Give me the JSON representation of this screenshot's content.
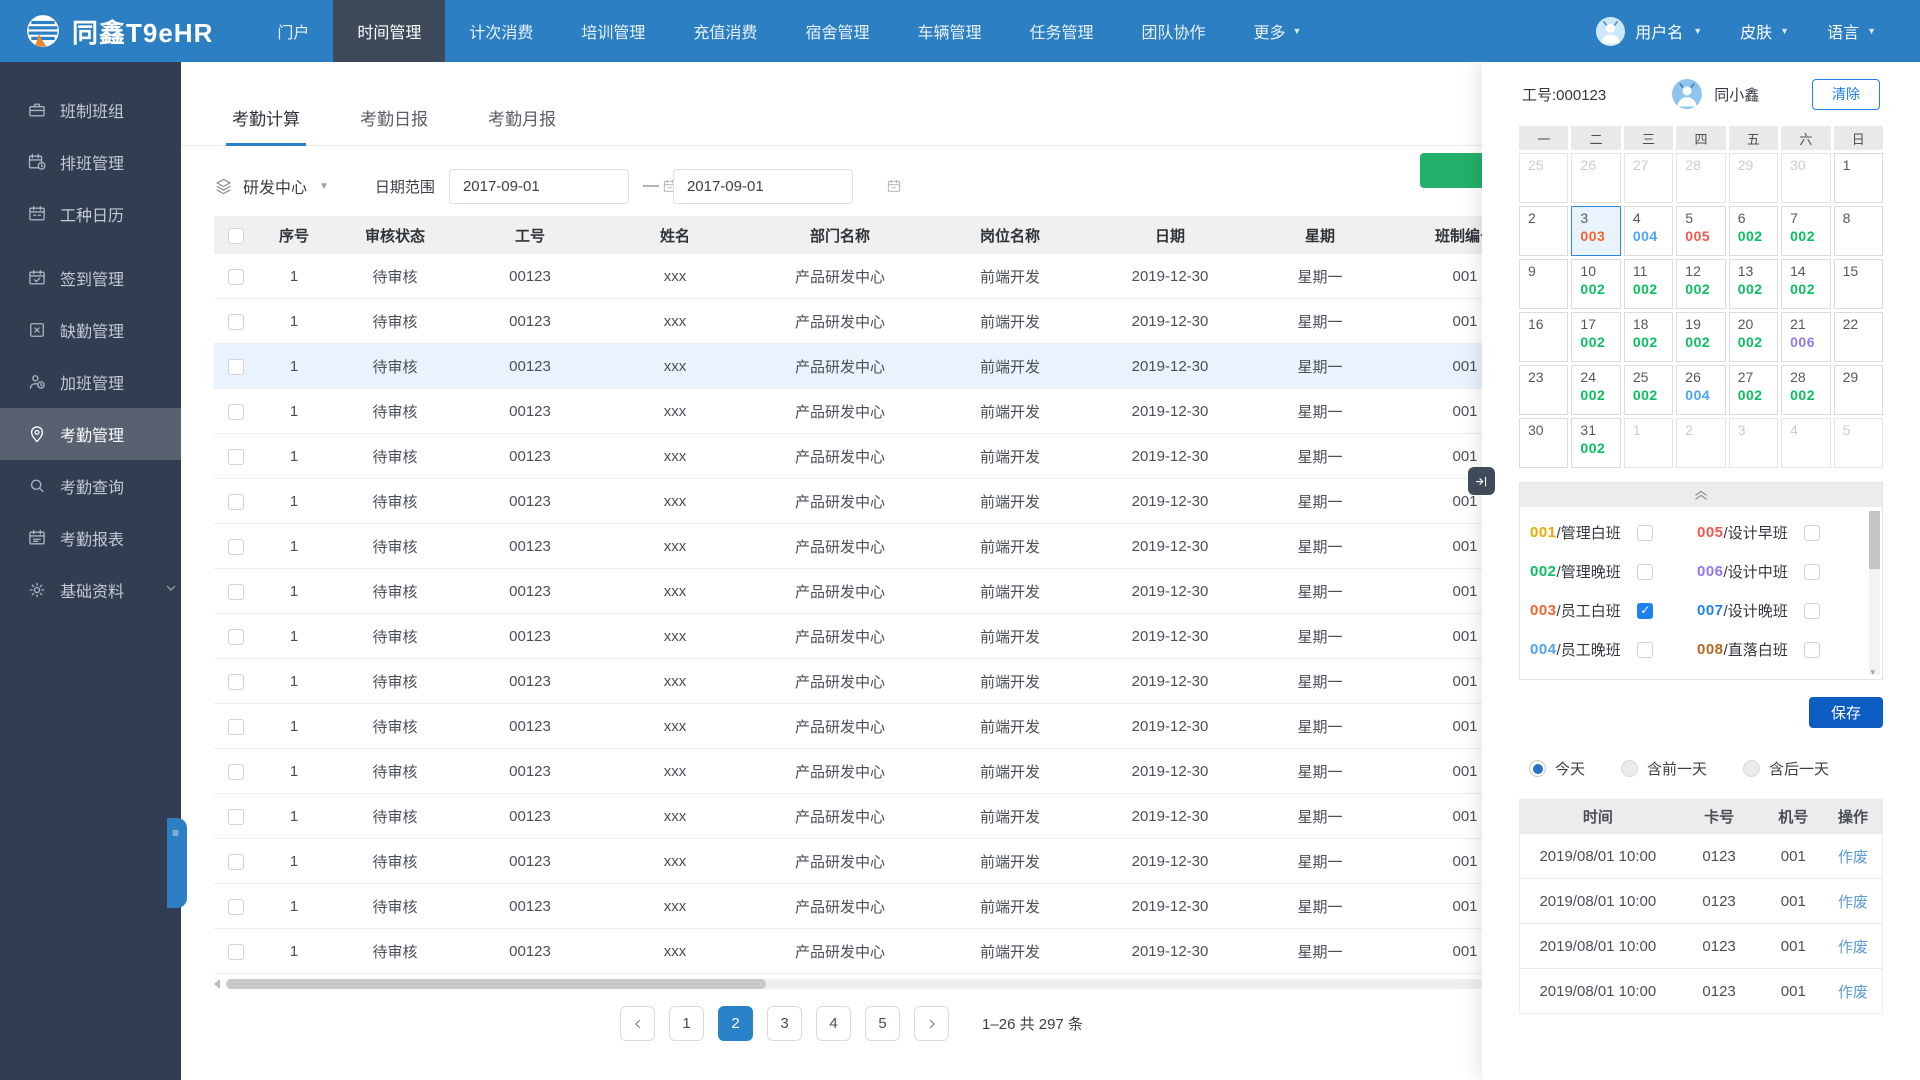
{
  "navbar": {
    "brand": "同鑫T9eHR",
    "menu": [
      {
        "label": "门户"
      },
      {
        "label": "时间管理"
      },
      {
        "label": "计次消费"
      },
      {
        "label": "培训管理"
      },
      {
        "label": "充值消费"
      },
      {
        "label": "宿舍管理"
      },
      {
        "label": "车辆管理"
      },
      {
        "label": "任务管理"
      },
      {
        "label": "团队协作"
      },
      {
        "label": "更多",
        "caret": true
      }
    ],
    "active_index": 1,
    "user": "用户名",
    "skin": "皮肤",
    "language": "语言"
  },
  "sidebar": {
    "items": [
      {
        "icon": "briefcase-icon",
        "label": "班制班组"
      },
      {
        "icon": "calendar-clock-icon",
        "label": "排班管理"
      },
      {
        "icon": "calendar-icon",
        "label": "工种日历"
      },
      {
        "icon": "calendar-check-icon",
        "label": "签到管理",
        "group_gap": true
      },
      {
        "icon": "calendar-x-icon",
        "label": "缺勤管理"
      },
      {
        "icon": "person-clock-icon",
        "label": "加班管理"
      },
      {
        "icon": "location-pin-icon",
        "label": "考勤管理",
        "active": true
      },
      {
        "icon": "search-icon",
        "label": "考勤查询"
      },
      {
        "icon": "calendar-report-icon",
        "label": "考勤报表"
      },
      {
        "icon": "gear-icon",
        "label": "基础资料",
        "caret": true
      }
    ]
  },
  "tabs": [
    {
      "label": "考勤计算",
      "active": true
    },
    {
      "label": "考勤日报"
    },
    {
      "label": "考勤月报"
    }
  ],
  "filters": {
    "department": "研发中心",
    "date_label": "日期范围",
    "date_from": "2017-09-01",
    "date_to": "2017-09-01",
    "range_separator": "—"
  },
  "table": {
    "columns": [
      "",
      "序号",
      "审核状态",
      "工号",
      "姓名",
      "部门名称",
      "岗位名称",
      "日期",
      "星期",
      "班制编号"
    ],
    "highlight_row": 2,
    "rows": [
      [
        "1",
        "待审核",
        "00123",
        "xxx",
        "产品研发中心",
        "前端开发",
        "2019-12-30",
        "星期一",
        "001"
      ],
      [
        "1",
        "待审核",
        "00123",
        "xxx",
        "产品研发中心",
        "前端开发",
        "2019-12-30",
        "星期一",
        "001"
      ],
      [
        "1",
        "待审核",
        "00123",
        "xxx",
        "产品研发中心",
        "前端开发",
        "2019-12-30",
        "星期一",
        "001"
      ],
      [
        "1",
        "待审核",
        "00123",
        "xxx",
        "产品研发中心",
        "前端开发",
        "2019-12-30",
        "星期一",
        "001"
      ],
      [
        "1",
        "待审核",
        "00123",
        "xxx",
        "产品研发中心",
        "前端开发",
        "2019-12-30",
        "星期一",
        "001"
      ],
      [
        "1",
        "待审核",
        "00123",
        "xxx",
        "产品研发中心",
        "前端开发",
        "2019-12-30",
        "星期一",
        "001"
      ],
      [
        "1",
        "待审核",
        "00123",
        "xxx",
        "产品研发中心",
        "前端开发",
        "2019-12-30",
        "星期一",
        "001"
      ],
      [
        "1",
        "待审核",
        "00123",
        "xxx",
        "产品研发中心",
        "前端开发",
        "2019-12-30",
        "星期一",
        "001"
      ],
      [
        "1",
        "待审核",
        "00123",
        "xxx",
        "产品研发中心",
        "前端开发",
        "2019-12-30",
        "星期一",
        "001"
      ],
      [
        "1",
        "待审核",
        "00123",
        "xxx",
        "产品研发中心",
        "前端开发",
        "2019-12-30",
        "星期一",
        "001"
      ],
      [
        "1",
        "待审核",
        "00123",
        "xxx",
        "产品研发中心",
        "前端开发",
        "2019-12-30",
        "星期一",
        "001"
      ],
      [
        "1",
        "待审核",
        "00123",
        "xxx",
        "产品研发中心",
        "前端开发",
        "2019-12-30",
        "星期一",
        "001"
      ],
      [
        "1",
        "待审核",
        "00123",
        "xxx",
        "产品研发中心",
        "前端开发",
        "2019-12-30",
        "星期一",
        "001"
      ],
      [
        "1",
        "待审核",
        "00123",
        "xxx",
        "产品研发中心",
        "前端开发",
        "2019-12-30",
        "星期一",
        "001"
      ],
      [
        "1",
        "待审核",
        "00123",
        "xxx",
        "产品研发中心",
        "前端开发",
        "2019-12-30",
        "星期一",
        "001"
      ],
      [
        "1",
        "待审核",
        "00123",
        "xxx",
        "产品研发中心",
        "前端开发",
        "2019-12-30",
        "星期一",
        "001"
      ]
    ]
  },
  "pagination": {
    "pages": [
      "1",
      "2",
      "3",
      "4",
      "5"
    ],
    "active_page": "2",
    "summary": "1–26  共 297 条"
  },
  "panel": {
    "employee_label": "工号:000123",
    "employee_name": "同小鑫",
    "clear_button": "清除",
    "calendar": {
      "weekdays": [
        "一",
        "二",
        "三",
        "四",
        "五",
        "六",
        "日"
      ],
      "cells": [
        {
          "d": "25",
          "muted": true
        },
        {
          "d": "26",
          "muted": true
        },
        {
          "d": "27",
          "muted": true
        },
        {
          "d": "28",
          "muted": true
        },
        {
          "d": "29",
          "muted": true
        },
        {
          "d": "30",
          "muted": true
        },
        {
          "d": "1"
        },
        {
          "d": "2"
        },
        {
          "d": "3",
          "code": "003",
          "selected": true
        },
        {
          "d": "4",
          "code": "004"
        },
        {
          "d": "5",
          "code": "005"
        },
        {
          "d": "6",
          "code": "002"
        },
        {
          "d": "7",
          "code": "002"
        },
        {
          "d": "8"
        },
        {
          "d": "9"
        },
        {
          "d": "10",
          "code": "002"
        },
        {
          "d": "11",
          "code": "002"
        },
        {
          "d": "12",
          "code": "002"
        },
        {
          "d": "13",
          "code": "002"
        },
        {
          "d": "14",
          "code": "002"
        },
        {
          "d": "15"
        },
        {
          "d": "16"
        },
        {
          "d": "17",
          "code": "002"
        },
        {
          "d": "18",
          "code": "002"
        },
        {
          "d": "19",
          "code": "002"
        },
        {
          "d": "20",
          "code": "002"
        },
        {
          "d": "21",
          "code": "006"
        },
        {
          "d": "22"
        },
        {
          "d": "23"
        },
        {
          "d": "24",
          "code": "002"
        },
        {
          "d": "25",
          "code": "002"
        },
        {
          "d": "26",
          "code": "004"
        },
        {
          "d": "27",
          "code": "002"
        },
        {
          "d": "28",
          "code": "002"
        },
        {
          "d": "29"
        },
        {
          "d": "30"
        },
        {
          "d": "31",
          "code": "002"
        },
        {
          "d": "1",
          "muted": true
        },
        {
          "d": "2",
          "muted": true
        },
        {
          "d": "3",
          "muted": true
        },
        {
          "d": "4",
          "muted": true
        },
        {
          "d": "5",
          "muted": true
        }
      ]
    },
    "shift_colors": {
      "001": "#f0a800",
      "002": "#0abf5f",
      "003": "#f2642c",
      "004": "#4aa3f5",
      "005": "#f5554f",
      "006": "#8d7af0",
      "007": "#2180f0",
      "008": "#b5691e"
    },
    "shifts": [
      {
        "code": "001",
        "name": "管理白班",
        "checked": false
      },
      {
        "code": "002",
        "name": "管理晚班",
        "checked": false
      },
      {
        "code": "003",
        "name": "员工白班",
        "checked": true
      },
      {
        "code": "004",
        "name": "员工晚班",
        "checked": false
      },
      {
        "code": "005",
        "name": "设计早班",
        "checked": false
      },
      {
        "code": "006",
        "name": "设计中班",
        "checked": false
      },
      {
        "code": "007",
        "name": "设计晚班",
        "checked": false
      },
      {
        "code": "008",
        "name": "直落白班",
        "checked": false
      }
    ],
    "save_button": "保存",
    "radios": [
      {
        "label": "今天",
        "selected": true
      },
      {
        "label": "含前一天",
        "selected": false
      },
      {
        "label": "含后一天",
        "selected": false
      }
    ],
    "log_table": {
      "columns": [
        "时间",
        "卡号",
        "机号",
        "操作"
      ],
      "rows": [
        {
          "time": "2019/08/01 10:00",
          "card": "0123",
          "machine": "001",
          "action": "作废"
        },
        {
          "time": "2019/08/01 10:00",
          "card": "0123",
          "machine": "001",
          "action": "作废"
        },
        {
          "time": "2019/08/01 10:00",
          "card": "0123",
          "machine": "001",
          "action": "作废"
        },
        {
          "time": "2019/08/01 10:00",
          "card": "0123",
          "machine": "001",
          "action": "作废"
        }
      ]
    }
  }
}
